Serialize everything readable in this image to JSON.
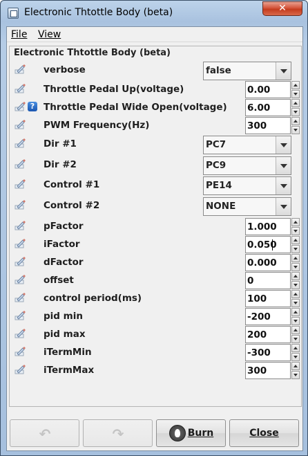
{
  "window": {
    "title": "Electronic Thtottle Body (beta)",
    "close_glyph": "✕",
    "icon": "application-window-icon"
  },
  "menu": [
    {
      "label": "File"
    },
    {
      "label": "View"
    }
  ],
  "panel": {
    "title": "Electronic Thtottle Body (beta)"
  },
  "fields": [
    {
      "label": "verbose",
      "control": "combo",
      "value": "false",
      "help": false
    },
    {
      "label": "Throttle Pedal Up(voltage)",
      "control": "spinner",
      "value": "0.00",
      "help": false
    },
    {
      "label": "Throttle Pedal Wide Open(voltage)",
      "control": "spinner",
      "value": "6.00",
      "help": true
    },
    {
      "label": "PWM Frequency(Hz)",
      "control": "spinner",
      "value": "300",
      "help": false
    },
    {
      "label": "Dir #1",
      "control": "combo",
      "value": "PC7",
      "help": false
    },
    {
      "label": "Dir #2",
      "control": "combo",
      "value": "PC9",
      "help": false
    },
    {
      "label": "Control #1",
      "control": "combo",
      "value": "PE14",
      "help": false
    },
    {
      "label": "Control #2",
      "control": "combo",
      "value": "NONE",
      "help": false
    },
    {
      "label": "pFactor",
      "control": "spinner",
      "value": "1.000",
      "help": false
    },
    {
      "label": "iFactor",
      "control": "spinner",
      "value": "0.050",
      "help": false
    },
    {
      "label": "dFactor",
      "control": "spinner",
      "value": "0.000",
      "help": false
    },
    {
      "label": "offset",
      "control": "spinner",
      "value": "0",
      "help": false
    },
    {
      "label": "control period(ms)",
      "control": "spinner",
      "value": "100",
      "help": false
    },
    {
      "label": "pid min",
      "control": "spinner",
      "value": "-200",
      "help": false
    },
    {
      "label": "pid max",
      "control": "spinner",
      "value": "200",
      "help": false
    },
    {
      "label": "iTermMin",
      "control": "spinner",
      "value": "-300",
      "help": false
    },
    {
      "label": "iTermMax",
      "control": "spinner",
      "value": "300",
      "help": false
    }
  ],
  "help_glyph": "?",
  "buttons": {
    "undo": {
      "icon": "undo-arrow-icon",
      "glyph": "↶",
      "enabled": false
    },
    "redo": {
      "icon": "redo-arrow-icon",
      "glyph": "↷",
      "enabled": false
    },
    "burn": {
      "label": "Burn",
      "icon": "burn-flame-icon"
    },
    "close": {
      "label": "Close"
    }
  },
  "colors": {
    "title_bar": "#a9c2df",
    "close_button": "#c43c1e",
    "help_icon": "#1a56b0"
  }
}
